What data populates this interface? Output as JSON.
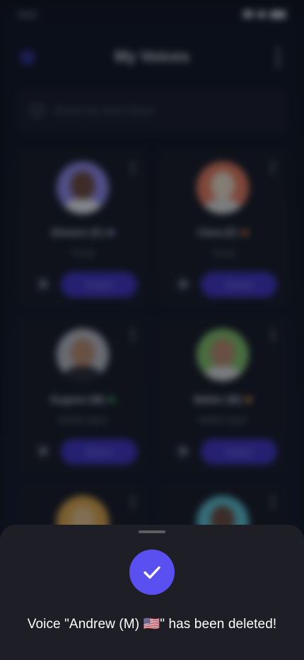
{
  "status_bar": {
    "time": "9:41"
  },
  "header": {
    "title": "My Voices"
  },
  "search": {
    "placeholder": "Search by Voice Name"
  },
  "voices": [
    {
      "name": "Eleanor (F)",
      "age": "Young",
      "flag_color": "#9fb0d6",
      "ring": "#8c86e6",
      "head": "#6a4a3c",
      "body": "#e9eaf0",
      "select_label": "Select"
    },
    {
      "name": "Clara (F)",
      "age": "Young",
      "flag_color": "#e07a3c",
      "ring": "#e07a5f",
      "head": "#e9dcc8",
      "body": "#dcdcdc",
      "select_label": "Select"
    },
    {
      "name": "Eugene (M)",
      "age": "Middle-Aged",
      "flag_color": "#3fae6a",
      "ring": "#b9bcc6",
      "head": "#b98a70",
      "body": "#2a2c33",
      "select_label": "Select"
    },
    {
      "name": "Walter (M)",
      "age": "Middle-Aged",
      "flag_color": "#e2a04a",
      "ring": "#7fbf6a",
      "head": "#b98a70",
      "body": "#d8d8dc",
      "select_label": "Select"
    },
    {
      "name": "",
      "age": "",
      "flag_color": "",
      "ring": "#d8a54a",
      "head": "#e4c08a",
      "body": "#d9b676",
      "select_label": ""
    },
    {
      "name": "",
      "age": "",
      "flag_color": "",
      "ring": "#5bbfd0",
      "head": "#6a4a3c",
      "body": "#2a2c33",
      "select_label": ""
    }
  ],
  "toast": {
    "message": "Voice \"Andrew (M) 🇺🇸\" has been deleted!",
    "icon": "check-icon",
    "accent": "#5a4ff0"
  }
}
